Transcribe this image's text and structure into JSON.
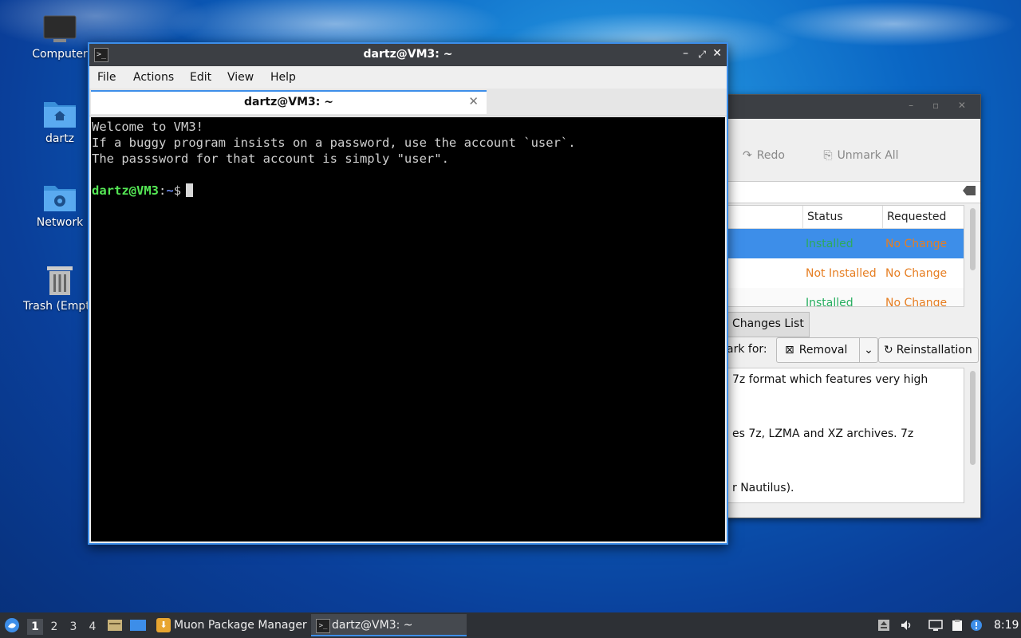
{
  "desktop": {
    "icons": [
      {
        "label": "Computer"
      },
      {
        "label": "dartz"
      },
      {
        "label": "Network"
      },
      {
        "label": "Trash (Empt"
      }
    ]
  },
  "muon": {
    "toolbar": {
      "redo": "Redo",
      "unmark_all": "Unmark All"
    },
    "table": {
      "headers": {
        "status": "Status",
        "requested": "Requested"
      },
      "rows": [
        {
          "status": "Installed",
          "requested": "No Change",
          "selected": true
        },
        {
          "status": "Not Installed",
          "requested": "No Change",
          "selected": false
        },
        {
          "status": "Installed",
          "requested": "No Change",
          "selected": false
        }
      ]
    },
    "tab_changes": "Changes List",
    "mark_for": "ark for:",
    "removal_button": "Removal",
    "reinstallation_button": "Reinstallation",
    "description_lines": [
      "7z format which features very high",
      "es 7z, LZMA and XZ archives. 7z",
      "r Nautilus)."
    ],
    "colors": {
      "installed": "#27ae60",
      "not_installed": "#e67e22",
      "no_change": "#e67e22",
      "selection": "#3d8ee9"
    }
  },
  "terminal": {
    "title": "dartz@VM3: ~",
    "menu": [
      "File",
      "Actions",
      "Edit",
      "View",
      "Help"
    ],
    "tab_label": "dartz@VM3: ~",
    "lines": [
      "Welcome to VM3!",
      "If a buggy program insists on a password, use the account `user`.",
      "The passsword for that account is simply \"user\"."
    ],
    "prompt_user": "dartz@VM3",
    "prompt_sep": ":",
    "prompt_path": "~",
    "prompt_symbol": "$"
  },
  "taskbar": {
    "workspaces": [
      "1",
      "2",
      "3",
      "4"
    ],
    "active_workspace": "1",
    "tasks": [
      {
        "label": "Muon Package Manager"
      },
      {
        "label": "dartz@VM3: ~"
      }
    ],
    "clock": "8:19"
  }
}
